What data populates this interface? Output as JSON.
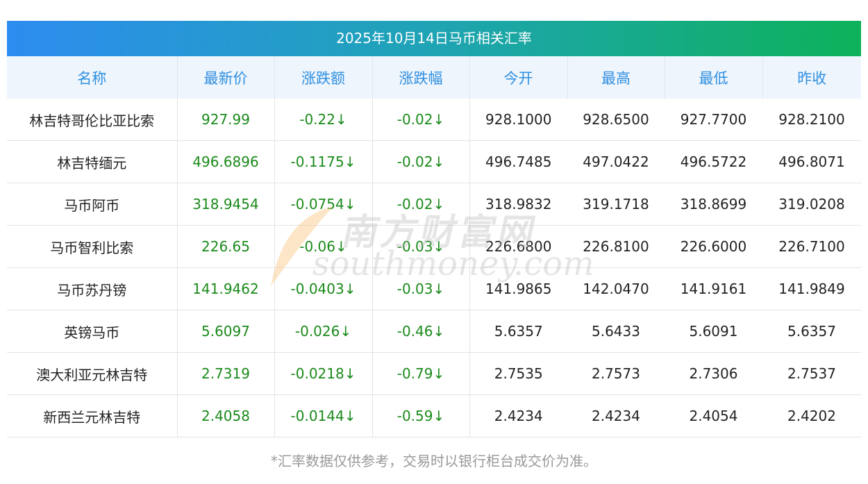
{
  "title": "2025年10月14日马币相关汇率",
  "columns": [
    "名称",
    "最新价",
    "涨跌额",
    "涨跌幅",
    "今开",
    "最高",
    "最低",
    "昨收"
  ],
  "rows": [
    {
      "name": "林吉特哥伦比亚比索",
      "latest": "927.99",
      "change": "-0.22↓",
      "pct": "-0.02↓",
      "open": "928.1000",
      "high": "928.6500",
      "low": "927.7700",
      "prev": "928.2100"
    },
    {
      "name": "林吉特缅元",
      "latest": "496.6896",
      "change": "-0.1175↓",
      "pct": "-0.02↓",
      "open": "496.7485",
      "high": "497.0422",
      "low": "496.5722",
      "prev": "496.8071"
    },
    {
      "name": "马币阿币",
      "latest": "318.9454",
      "change": "-0.0754↓",
      "pct": "-0.02↓",
      "open": "318.9832",
      "high": "319.1718",
      "low": "318.8699",
      "prev": "319.0208"
    },
    {
      "name": "马币智利比索",
      "latest": "226.65",
      "change": "-0.06↓",
      "pct": "-0.03↓",
      "open": "226.6800",
      "high": "226.8100",
      "low": "226.6000",
      "prev": "226.7100"
    },
    {
      "name": "马币苏丹镑",
      "latest": "141.9462",
      "change": "-0.0403↓",
      "pct": "-0.03↓",
      "open": "141.9865",
      "high": "142.0470",
      "low": "141.9161",
      "prev": "141.9849"
    },
    {
      "name": "英镑马币",
      "latest": "5.6097",
      "change": "-0.026↓",
      "pct": "-0.46↓",
      "open": "5.6357",
      "high": "5.6433",
      "low": "5.6091",
      "prev": "5.6357"
    },
    {
      "name": "澳大利亚元林吉特",
      "latest": "2.7319",
      "change": "-0.0218↓",
      "pct": "-0.79↓",
      "open": "2.7535",
      "high": "2.7573",
      "low": "2.7306",
      "prev": "2.7537"
    },
    {
      "name": "新西兰元林吉特",
      "latest": "2.4058",
      "change": "-0.0144↓",
      "pct": "-0.59↓",
      "open": "2.4234",
      "high": "2.4234",
      "low": "2.4054",
      "prev": "2.4202"
    }
  ],
  "footer": "*汇率数据仅供参考，交易时以银行柜台成交价为准。",
  "watermark": {
    "cn": "南方财富网",
    "en": "southmoney.com"
  },
  "colors": {
    "header_text": "#2f8fe0",
    "header_bg": "#eef5fd",
    "down": "#1a8a1a",
    "title_gradient_start": "#2d8cf0",
    "title_gradient_end": "#0db25a"
  }
}
